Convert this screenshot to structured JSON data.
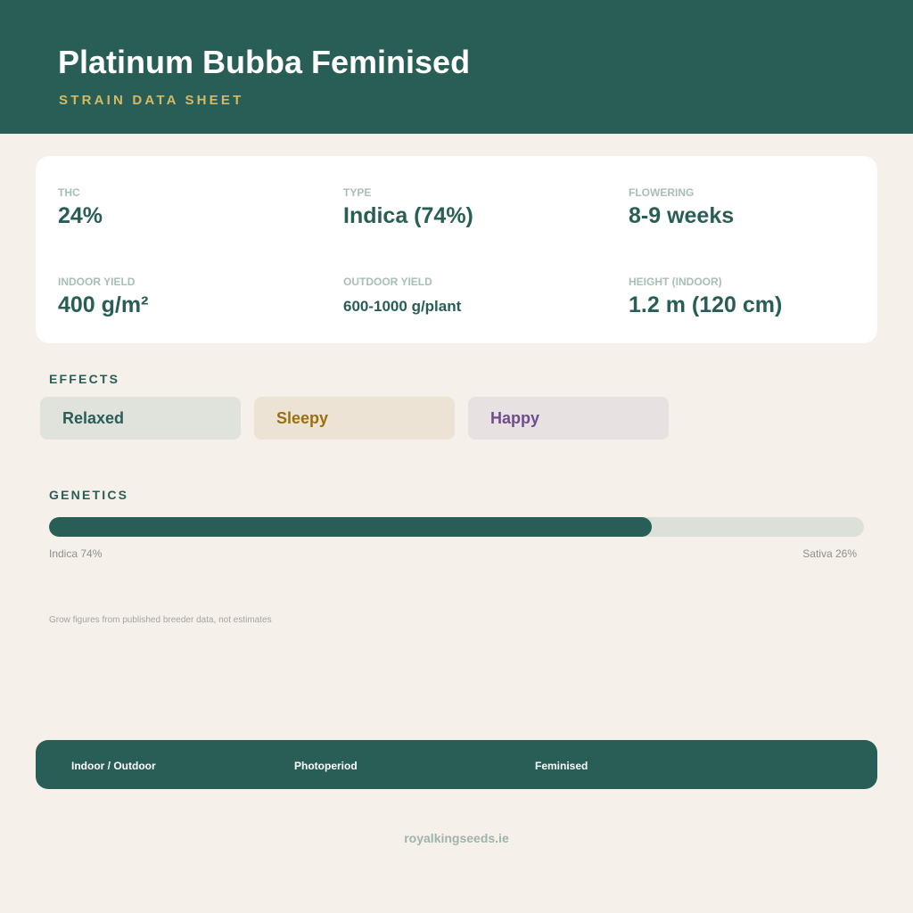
{
  "header": {
    "title": "Platinum Bubba Feminised",
    "subtitle": "STRAIN DATA SHEET"
  },
  "stats": [
    {
      "label": "THC",
      "value": "24%"
    },
    {
      "label": "TYPE",
      "value": "Indica (74%)"
    },
    {
      "label": "FLOWERING",
      "value": "8-9 weeks"
    },
    {
      "label": "INDOOR YIELD",
      "value": "400 g/m²"
    },
    {
      "label": "OUTDOOR YIELD",
      "value": "600-1000 g/plant"
    },
    {
      "label": "HEIGHT (INDOOR)",
      "value": "1.2 m (120 cm)"
    }
  ],
  "effects": {
    "label": "EFFECTS",
    "items": [
      {
        "label": "Relaxed",
        "text_color": "#285e55",
        "bg_color": "#e0e2dc"
      },
      {
        "label": "Sleepy",
        "text_color": "#9a6f12",
        "bg_color": "#ede3d4"
      },
      {
        "label": "Happy",
        "text_color": "#6e4c8e",
        "bg_color": "#e8e1e2"
      }
    ]
  },
  "genetics": {
    "label": "GENETICS",
    "indica_percent": 74,
    "indica_label": "Indica 74%",
    "sativa_label": "Sativa 26%"
  },
  "note": "Grow figures from published breeder data, not estimates",
  "footer": {
    "items": [
      "Indoor / Outdoor",
      "Photoperiod",
      "Feminised"
    ],
    "website": "royalkingseeds.ie"
  },
  "colors": {
    "primary": "#285e55",
    "accent": "#d4ba66",
    "background": "#f5f0ea"
  }
}
